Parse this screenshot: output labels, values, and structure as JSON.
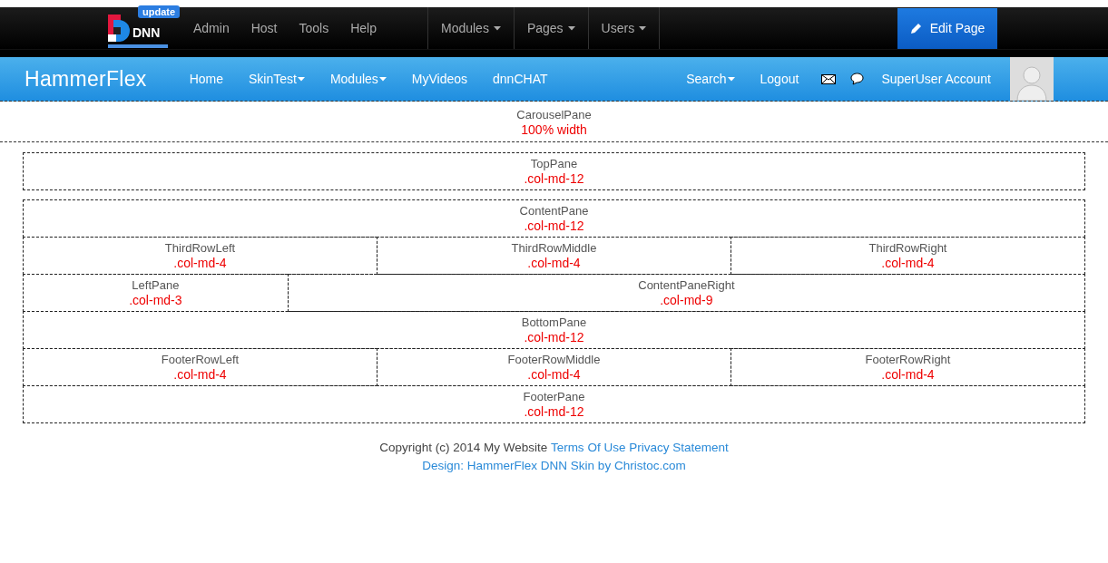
{
  "control_bar": {
    "logo_text": "DNN",
    "badge": "update",
    "menu": [
      {
        "label": "Admin"
      },
      {
        "label": "Host"
      },
      {
        "label": "Tools"
      },
      {
        "label": "Help"
      }
    ],
    "dropdowns": [
      {
        "label": "Modules"
      },
      {
        "label": "Pages"
      },
      {
        "label": "Users"
      }
    ],
    "edit_button": "Edit Page"
  },
  "nav": {
    "brand": "HammerFlex",
    "items": [
      {
        "label": "Home",
        "dropdown": false
      },
      {
        "label": "SkinTest",
        "dropdown": true
      },
      {
        "label": "Modules",
        "dropdown": true
      },
      {
        "label": "MyVideos",
        "dropdown": false
      },
      {
        "label": "dnnCHAT",
        "dropdown": false
      }
    ],
    "search": "Search",
    "logout": "Logout",
    "account": "SuperUser Account"
  },
  "carousel": {
    "name": "CarouselPane",
    "class": "100% width"
  },
  "panes": [
    {
      "cells": [
        {
          "name": "TopPane",
          "class": ".col-md-12",
          "kind": "full"
        }
      ]
    },
    {
      "cells": [
        {
          "name": "ContentPane",
          "class": ".col-md-12",
          "kind": "full"
        }
      ]
    },
    {
      "cells": [
        {
          "name": "ThirdRowLeft",
          "class": ".col-md-4",
          "kind": "third"
        },
        {
          "name": "ThirdRowMiddle",
          "class": ".col-md-4",
          "kind": "third"
        },
        {
          "name": "ThirdRowRight",
          "class": ".col-md-4",
          "kind": "third"
        }
      ]
    },
    {
      "cells": [
        {
          "name": "LeftPane",
          "class": ".col-md-3",
          "kind": "quarter"
        },
        {
          "name": "ContentPaneRight",
          "class": ".col-md-9",
          "kind": "three-quarters"
        }
      ]
    },
    {
      "cells": [
        {
          "name": "BottomPane",
          "class": ".col-md-12",
          "kind": "full"
        }
      ]
    },
    {
      "cells": [
        {
          "name": "FooterRowLeft",
          "class": ".col-md-4",
          "kind": "third"
        },
        {
          "name": "FooterRowMiddle",
          "class": ".col-md-4",
          "kind": "third"
        },
        {
          "name": "FooterRowRight",
          "class": ".col-md-4",
          "kind": "third"
        }
      ]
    },
    {
      "cells": [
        {
          "name": "FooterPane",
          "class": ".col-md-12",
          "kind": "full"
        }
      ]
    }
  ],
  "footer": {
    "copyright": "Copyright (c) 2014 My Website",
    "terms": "Terms Of Use",
    "privacy": "Privacy Statement",
    "design": "Design: HammerFlex DNN Skin by Christoc.com"
  }
}
